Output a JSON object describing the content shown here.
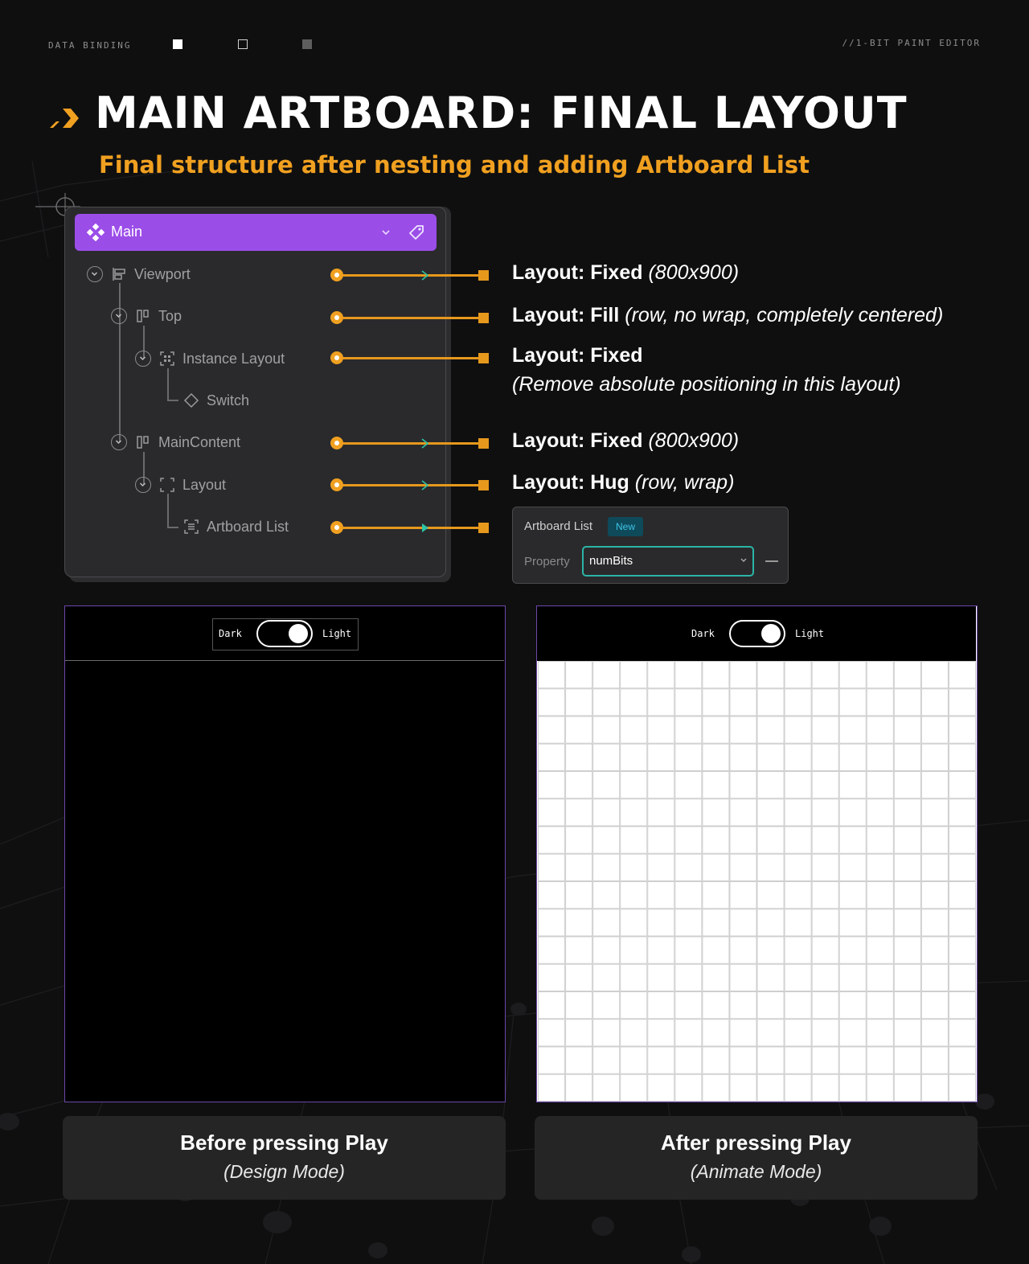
{
  "header": {
    "left_label": "DATA BINDING",
    "right_label": "//1-BIT PAINT EDITOR"
  },
  "title": "MAIN ARTBOARD: FINAL LAYOUT",
  "subtitle": "Final structure after nesting and adding Artboard List",
  "colors": {
    "accent_orange": "#f0a020",
    "main_purple": "#9b4de8",
    "frame_border": "#6b48a8",
    "teal": "#2bb5a6"
  },
  "layers_panel": {
    "component_name": "Main",
    "component_icon": "component-icon",
    "items": [
      {
        "label": "Viewport",
        "icon": "layout-stack-icon"
      },
      {
        "label": "Top",
        "icon": "layout-columns-icon"
      },
      {
        "label": "Instance Layout",
        "icon": "instance-frame-icon"
      },
      {
        "label": "Switch",
        "icon": "diamond-icon"
      },
      {
        "label": "MainContent",
        "icon": "layout-columns-icon"
      },
      {
        "label": "Layout",
        "icon": "frame-corners-icon"
      },
      {
        "label": "Artboard List",
        "icon": "list-frame-icon"
      }
    ]
  },
  "annotations": [
    {
      "bold": "Layout: Fixed",
      "detail": "(800x900)"
    },
    {
      "bold": "Layout: Fill",
      "detail": "(row, no wrap, completely centered)"
    },
    {
      "bold": "Layout: Fixed",
      "detail": "(Remove absolute positioning in this layout)"
    },
    {
      "bold": "Layout: Fixed",
      "detail": "(800x900)"
    },
    {
      "bold": "Layout: Hug",
      "detail": "(row, wrap)"
    }
  ],
  "artboard_list_panel": {
    "title": "Artboard List",
    "badge": "New",
    "property_label": "Property",
    "property_value": "numBits"
  },
  "previews": {
    "toggle_dark": "Dark",
    "toggle_light": "Light",
    "before": {
      "title": "Before pressing Play",
      "subtitle": "(Design Mode)"
    },
    "after": {
      "title": "After pressing Play",
      "subtitle": "(Animate Mode)"
    }
  }
}
